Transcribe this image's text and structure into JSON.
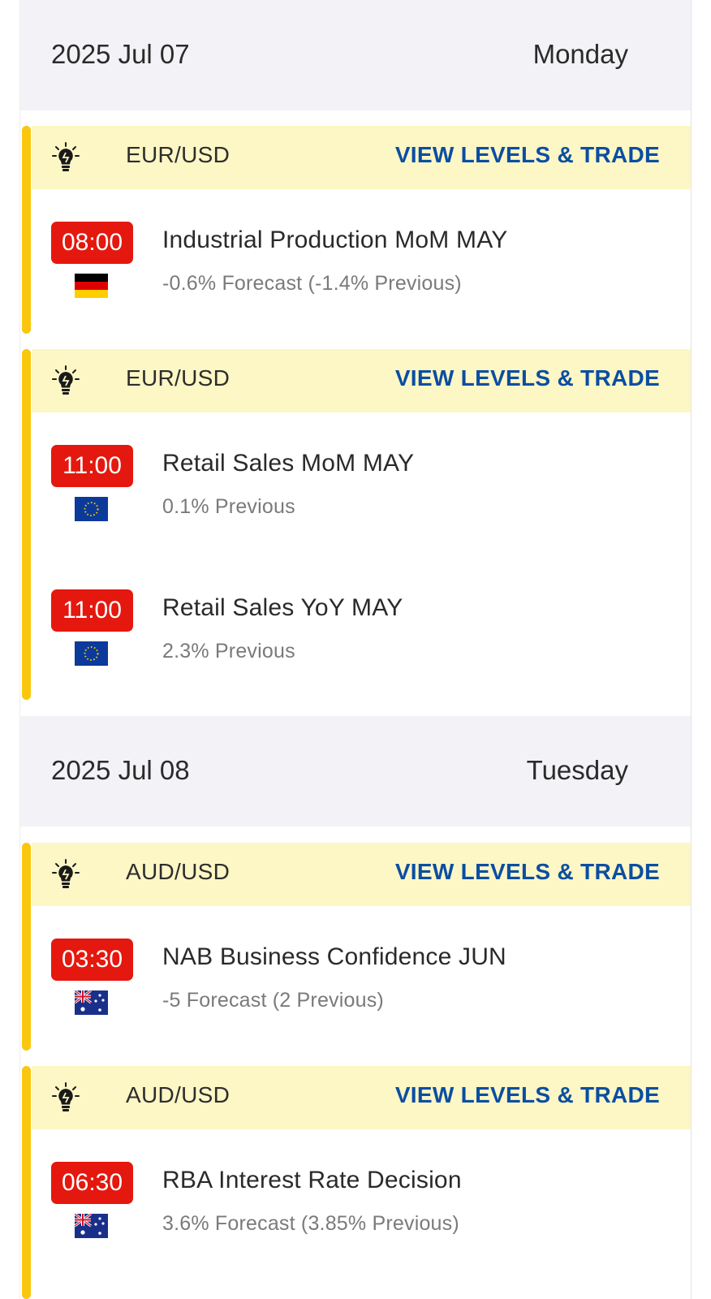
{
  "days": [
    {
      "date": "2025 Jul 07",
      "weekday": "Monday",
      "groups": [
        {
          "pair": "EUR/USD",
          "cta": "VIEW LEVELS & TRADE",
          "events": [
            {
              "time": "08:00",
              "flag": "germany-flag",
              "title": "Industrial Production MoM MAY",
              "detail": "-0.6% Forecast (-1.4% Previous)"
            }
          ]
        },
        {
          "pair": "EUR/USD",
          "cta": "VIEW LEVELS & TRADE",
          "events": [
            {
              "time": "11:00",
              "flag": "eu-flag",
              "title": "Retail Sales MoM MAY",
              "detail": "0.1% Previous"
            },
            {
              "time": "11:00",
              "flag": "eu-flag",
              "title": "Retail Sales YoY MAY",
              "detail": "2.3% Previous"
            }
          ]
        }
      ]
    },
    {
      "date": "2025 Jul 08",
      "weekday": "Tuesday",
      "groups": [
        {
          "pair": "AUD/USD",
          "cta": "VIEW LEVELS & TRADE",
          "events": [
            {
              "time": "03:30",
              "flag": "australia-flag",
              "title": "NAB Business Confidence JUN",
              "detail": "-5 Forecast (2 Previous)"
            }
          ]
        },
        {
          "pair": "AUD/USD",
          "cta": "VIEW LEVELS & TRADE",
          "events": [
            {
              "time": "06:30",
              "flag": "australia-flag",
              "title": "RBA Interest Rate Decision",
              "detail": "3.6% Forecast (3.85% Previous)"
            }
          ]
        }
      ]
    }
  ],
  "colors": {
    "accent_bar": "#f9c80e",
    "header_bg": "#fdf6c5",
    "cta": "#0a4ea2",
    "time_badge": "#e4180e",
    "day_bg": "#f3f2f6"
  },
  "icons": {
    "idea": "lightbulb-icon"
  }
}
